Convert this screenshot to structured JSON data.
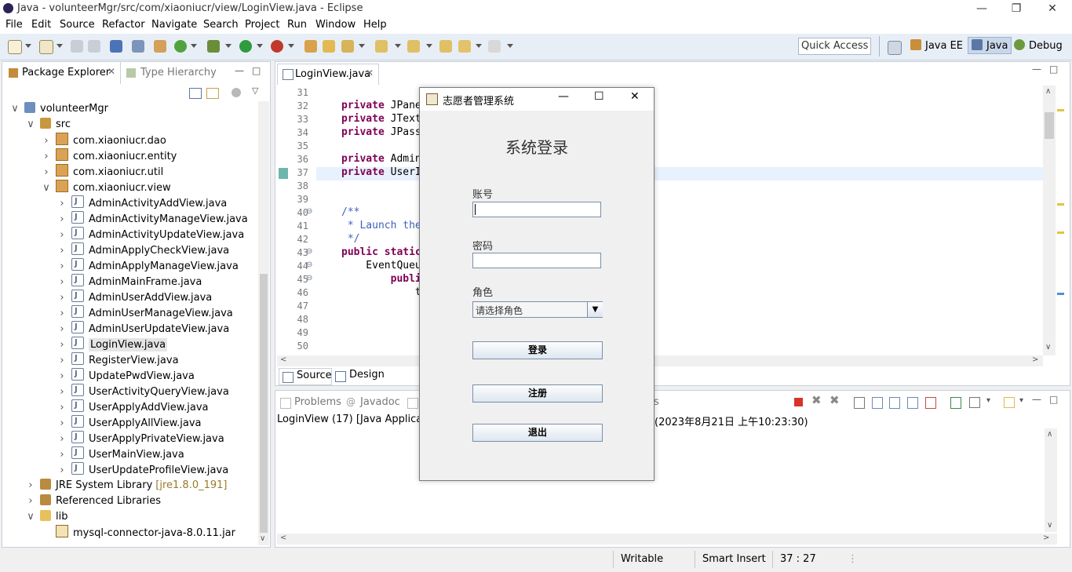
{
  "window": {
    "title": "Java - volunteerMgr/src/com/xiaoniucr/view/LoginView.java - Eclipse",
    "minimize": "—",
    "restore": "❐",
    "close": "✕"
  },
  "menu": [
    "File",
    "Edit",
    "Source",
    "Refactor",
    "Navigate",
    "Search",
    "Project",
    "Run",
    "Window",
    "Help"
  ],
  "toolbar": {
    "quick_access_placeholder": "Quick Access",
    "perspectives": [
      "Java EE",
      "Java",
      "Debug"
    ]
  },
  "package_explorer": {
    "tab_label": "Package Explorer",
    "tab2_label": "Type Hierarchy",
    "tree": [
      {
        "label": "volunteerMgr",
        "level": 0,
        "chevron": "v",
        "icon": "project"
      },
      {
        "label": "src",
        "level": 1,
        "chevron": "v",
        "icon": "src"
      },
      {
        "label": "com.xiaoniucr.dao",
        "level": 2,
        "chevron": ">",
        "icon": "package"
      },
      {
        "label": "com.xiaoniucr.entity",
        "level": 2,
        "chevron": ">",
        "icon": "package"
      },
      {
        "label": "com.xiaoniucr.util",
        "level": 2,
        "chevron": ">",
        "icon": "package"
      },
      {
        "label": "com.xiaoniucr.view",
        "level": 2,
        "chevron": "v",
        "icon": "package"
      },
      {
        "label": "AdminActivityAddView.java",
        "level": 3,
        "chevron": ">",
        "icon": "java"
      },
      {
        "label": "AdminActivityManageView.java",
        "level": 3,
        "chevron": ">",
        "icon": "java"
      },
      {
        "label": "AdminActivityUpdateView.java",
        "level": 3,
        "chevron": ">",
        "icon": "java"
      },
      {
        "label": "AdminApplyCheckView.java",
        "level": 3,
        "chevron": ">",
        "icon": "java"
      },
      {
        "label": "AdminApplyManageView.java",
        "level": 3,
        "chevron": ">",
        "icon": "java"
      },
      {
        "label": "AdminMainFrame.java",
        "level": 3,
        "chevron": ">",
        "icon": "java"
      },
      {
        "label": "AdminUserAddView.java",
        "level": 3,
        "chevron": ">",
        "icon": "java"
      },
      {
        "label": "AdminUserManageView.java",
        "level": 3,
        "chevron": ">",
        "icon": "java"
      },
      {
        "label": "AdminUserUpdateView.java",
        "level": 3,
        "chevron": ">",
        "icon": "java"
      },
      {
        "label": "LoginView.java",
        "level": 3,
        "chevron": ">",
        "icon": "java",
        "selected": true
      },
      {
        "label": "RegisterView.java",
        "level": 3,
        "chevron": ">",
        "icon": "java"
      },
      {
        "label": "UpdatePwdView.java",
        "level": 3,
        "chevron": ">",
        "icon": "java"
      },
      {
        "label": "UserActivityQueryView.java",
        "level": 3,
        "chevron": ">",
        "icon": "java"
      },
      {
        "label": "UserApplyAddView.java",
        "level": 3,
        "chevron": ">",
        "icon": "java"
      },
      {
        "label": "UserApplyAllView.java",
        "level": 3,
        "chevron": ">",
        "icon": "java"
      },
      {
        "label": "UserApplyPrivateView.java",
        "level": 3,
        "chevron": ">",
        "icon": "java"
      },
      {
        "label": "UserMainView.java",
        "level": 3,
        "chevron": ">",
        "icon": "java"
      },
      {
        "label": "UserUpdateProfileView.java",
        "level": 3,
        "chevron": ">",
        "icon": "java"
      },
      {
        "label": "JRE System Library",
        "suffix": "[jre1.8.0_191]",
        "level": 1,
        "chevron": ">",
        "icon": "lib"
      },
      {
        "label": "Referenced Libraries",
        "level": 1,
        "chevron": ">",
        "icon": "lib"
      },
      {
        "label": "lib",
        "level": 1,
        "chevron": "v",
        "icon": "folder"
      },
      {
        "label": "mysql-connector-java-8.0.11.jar",
        "level": 2,
        "chevron": "",
        "icon": "jar"
      }
    ]
  },
  "editor": {
    "tab_label": "LoginView.java",
    "bottom_tabs": [
      "Source",
      "Design"
    ],
    "lines": [
      {
        "n": "31",
        "code": ""
      },
      {
        "n": "32",
        "kw": "private",
        "rest": " JPane"
      },
      {
        "n": "33",
        "kw": "private",
        "rest": " JText"
      },
      {
        "n": "34",
        "kw": "private",
        "rest": " JPass"
      },
      {
        "n": "35",
        "code": ""
      },
      {
        "n": "36",
        "kw": "private",
        "rest": " Admin"
      },
      {
        "n": "37",
        "kw": "private",
        "rest": " UserI"
      },
      {
        "n": "38",
        "code": ""
      },
      {
        "n": "39",
        "code": ""
      },
      {
        "n": "40",
        "cm": "/**"
      },
      {
        "n": "41",
        "cm": " * Launch the"
      },
      {
        "n": "42",
        "cm": " */"
      },
      {
        "n": "43",
        "kw": "public",
        "kw2": " static",
        "rest": ""
      },
      {
        "n": "44",
        "code": "    EventQueu"
      },
      {
        "n": "45",
        "kw": "        publi",
        "rest": ""
      },
      {
        "n": "46",
        "code": "            t"
      },
      {
        "n": "47",
        "code": ""
      },
      {
        "n": "48",
        "code": ""
      },
      {
        "n": "49",
        "code": "            "
      },
      {
        "n": "50",
        "code": ""
      }
    ]
  },
  "console": {
    "tabs": [
      "Problems",
      "Javadoc"
    ],
    "tab_fragment": "s",
    "launch_left": "LoginView (17) [Java Application",
    "launch_right": "(2023年8月21日 上午10:23:30)"
  },
  "dialog": {
    "title": "志愿者管理系统",
    "heading": "系统登录",
    "account_label": "账号",
    "password_label": "密码",
    "role_label": "角色",
    "role_selected": "请选择角色",
    "login_button": "登录",
    "register_button": "注册",
    "exit_button": "退出"
  },
  "statusbar": {
    "writable": "Writable",
    "insert_mode": "Smart Insert",
    "position": "37 : 27"
  }
}
